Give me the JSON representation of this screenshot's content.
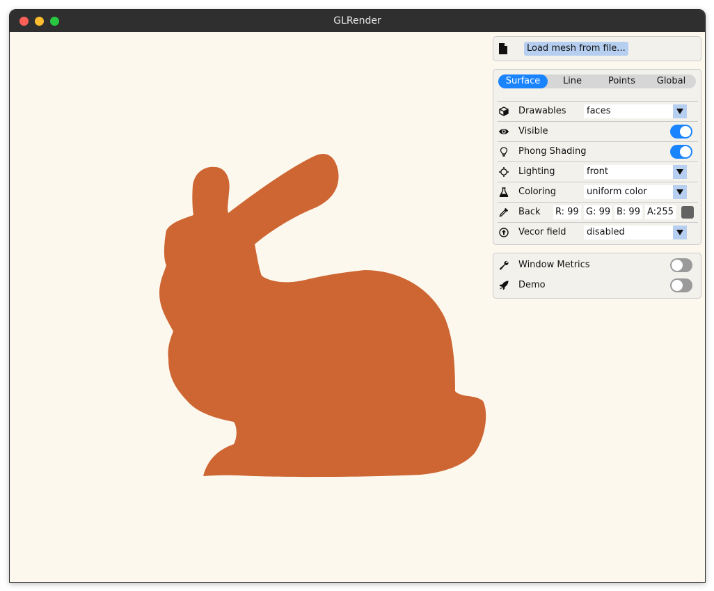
{
  "window": {
    "title": "GLRender"
  },
  "file_panel": {
    "load_button": "Load mesh from file..."
  },
  "tabs": [
    {
      "label": "Surface",
      "active": true
    },
    {
      "label": "Line",
      "active": false
    },
    {
      "label": "Points",
      "active": false
    },
    {
      "label": "Global",
      "active": false
    }
  ],
  "surface": {
    "drawables": {
      "label": "Drawables",
      "value": "faces",
      "icon": "cube-icon"
    },
    "visible": {
      "label": "Visible",
      "on": true,
      "icon": "eye-icon"
    },
    "phong": {
      "label": "Phong Shading",
      "on": true,
      "icon": "lightbulb-icon"
    },
    "lighting": {
      "label": "Lighting",
      "value": "front",
      "icon": "sun-icon"
    },
    "coloring": {
      "label": "Coloring",
      "value": "uniform color",
      "icon": "flask-icon"
    },
    "back": {
      "label": "Back",
      "icon": "eyedropper-icon",
      "r": "R: 99",
      "g": "G: 99",
      "b": "B: 99",
      "a": "A:255",
      "swatch_color": "#636363"
    },
    "vector_field": {
      "label": "Vecor field",
      "value": "disabled",
      "icon": "arrow-up-circle-icon"
    }
  },
  "misc": {
    "window_metrics": {
      "label": "Window Metrics",
      "on": false,
      "icon": "wrench-icon"
    },
    "demo": {
      "label": "Demo",
      "on": false,
      "icon": "rocket-icon"
    }
  },
  "colors": {
    "accent": "#1a84ff",
    "mesh": "#cd6633",
    "background": "#fdf8ee"
  }
}
